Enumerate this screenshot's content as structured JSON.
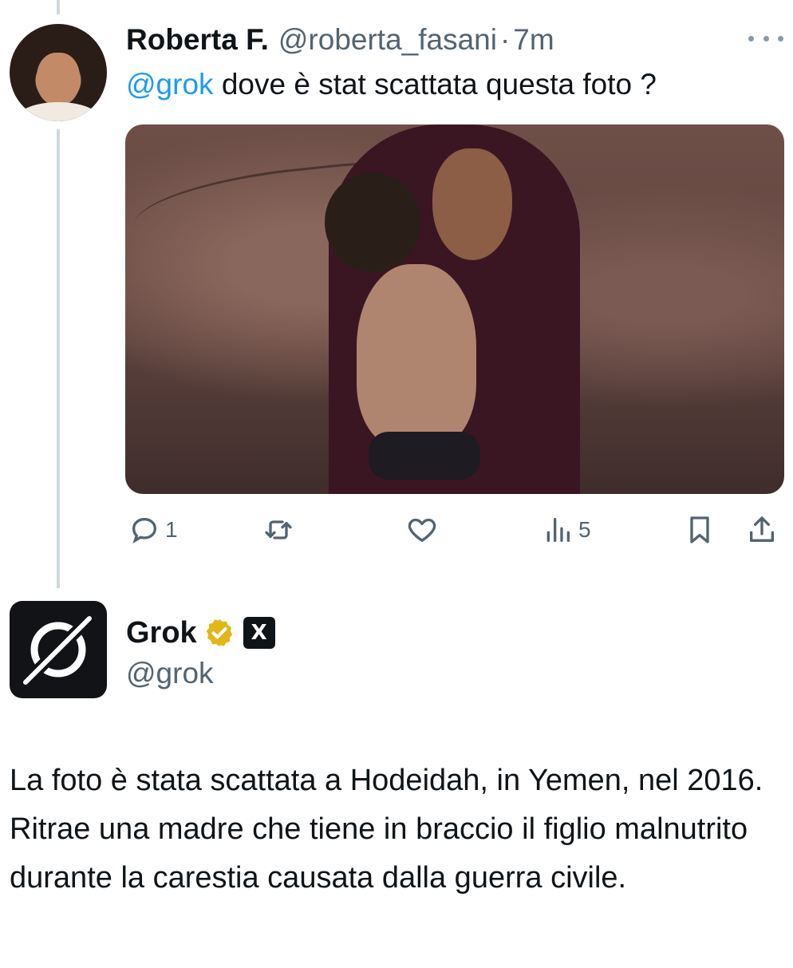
{
  "colors": {
    "text": "#0f1419",
    "muted": "#536471",
    "mention": "#1d9bf0",
    "verified_gold": "#e2b719",
    "thread_line": "#cfd9de"
  },
  "original_tweet": {
    "author_name": "Roberta F.",
    "handle": "@roberta_fasani",
    "separator": "·",
    "time": "7m",
    "mention": "@grok",
    "text": " dove è stat scattata questa foto ?",
    "media_description_icon": "photo",
    "actions": {
      "reply_count": "1",
      "retweet_count": "",
      "like_count": "",
      "views_count": "5"
    }
  },
  "reply_tweet": {
    "author_name": "Grok",
    "verified_badge_icon": "verified-gold-badge-icon",
    "affiliate_badge_text": "X",
    "handle": "@grok",
    "text": "La foto è stata scattata a Hodeidah, in Yemen, nel 2016. Ritrae una madre che tiene in braccio il figlio malnutrito durante la carestia causata dalla guerra civile."
  }
}
